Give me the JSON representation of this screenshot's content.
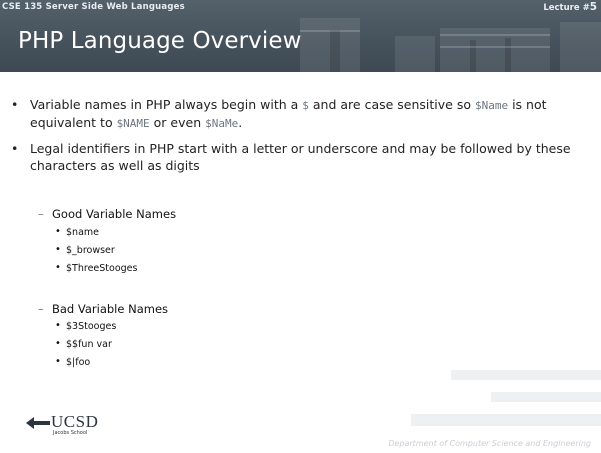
{
  "header": {
    "course": "CSE 135   Server Side Web Languages",
    "lecture_label": "Lecture #",
    "lecture_number": "5",
    "title": "PHP Language Overview"
  },
  "bullets": [
    {
      "parts": [
        "Variable names in PHP always begin with a ",
        "$",
        " and are case sensitive so ",
        "$Name",
        " is not equivalent to ",
        "$NAME",
        " or even ",
        "$NaMe",
        "."
      ]
    },
    {
      "text": "Legal identifiers in PHP start with a letter or underscore and may be followed by these characters as well as digits"
    }
  ],
  "good": {
    "heading": "Good Variable Names",
    "items": [
      "$name",
      "$_browser",
      "$ThreeStooges"
    ]
  },
  "bad": {
    "heading": "Bad Variable Names",
    "items": [
      "$3Stooges",
      "$$fun var",
      "$|foo"
    ]
  },
  "footer": {
    "logo_text": "UCSD",
    "logo_sub": "Jacobs School",
    "department": "Department of Computer Science and Engineering"
  }
}
